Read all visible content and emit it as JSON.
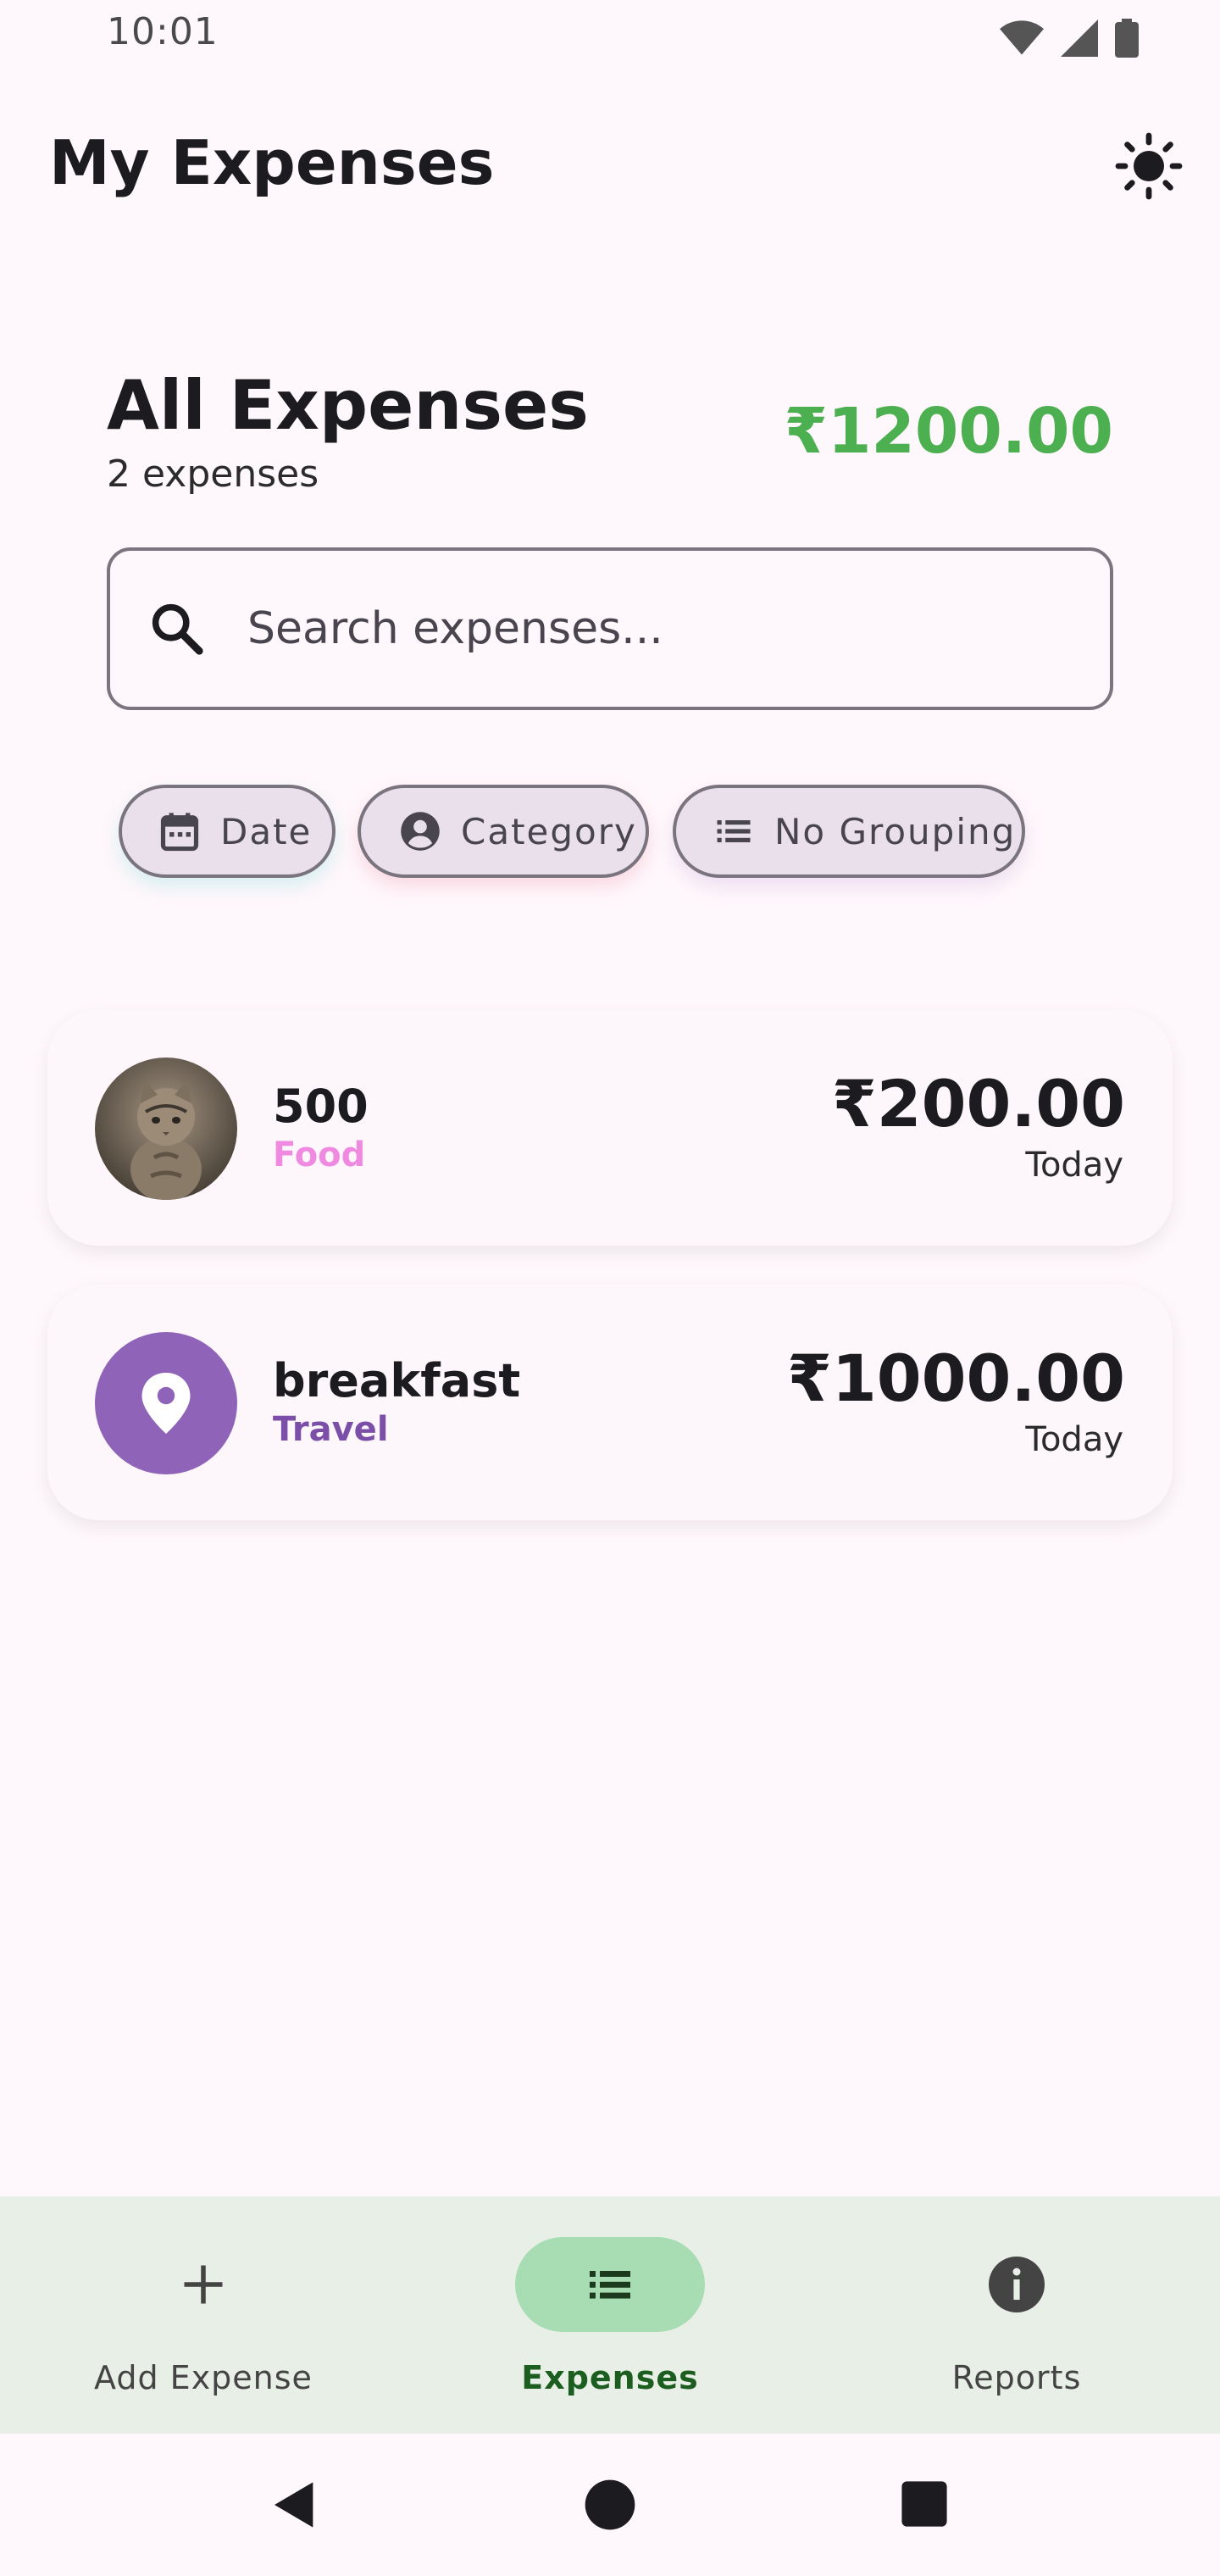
{
  "status_bar": {
    "time": "10:01"
  },
  "app_bar": {
    "title": "My Expenses"
  },
  "summary": {
    "title": "All Expenses",
    "count_text": "2 expenses",
    "total": "₹1200.00"
  },
  "search": {
    "placeholder": "Search expenses...",
    "value": ""
  },
  "filters": [
    {
      "label": "Date",
      "icon": "calendar-icon"
    },
    {
      "label": "Category",
      "icon": "account-circle-icon"
    },
    {
      "label": "No Grouping",
      "icon": "list-icon"
    }
  ],
  "expenses": [
    {
      "name": "500",
      "category": "Food",
      "category_color": "#F08AE0",
      "amount": "₹200.00",
      "date": "Today",
      "avatar": "cat-photo"
    },
    {
      "name": "breakfast",
      "category": "Travel",
      "category_color": "#7B4FA8",
      "amount": "₹1000.00",
      "date": "Today",
      "avatar": "location-pin-icon"
    }
  ],
  "bottom_nav": [
    {
      "label": "Add Expense",
      "icon": "plus-icon",
      "active": false
    },
    {
      "label": "Expenses",
      "icon": "list-icon",
      "active": true
    },
    {
      "label": "Reports",
      "icon": "info-icon",
      "active": false
    }
  ],
  "colors": {
    "accent_green": "#4CAF50",
    "active_pill": "#A8DDB3",
    "background": "#FEF7FB"
  }
}
